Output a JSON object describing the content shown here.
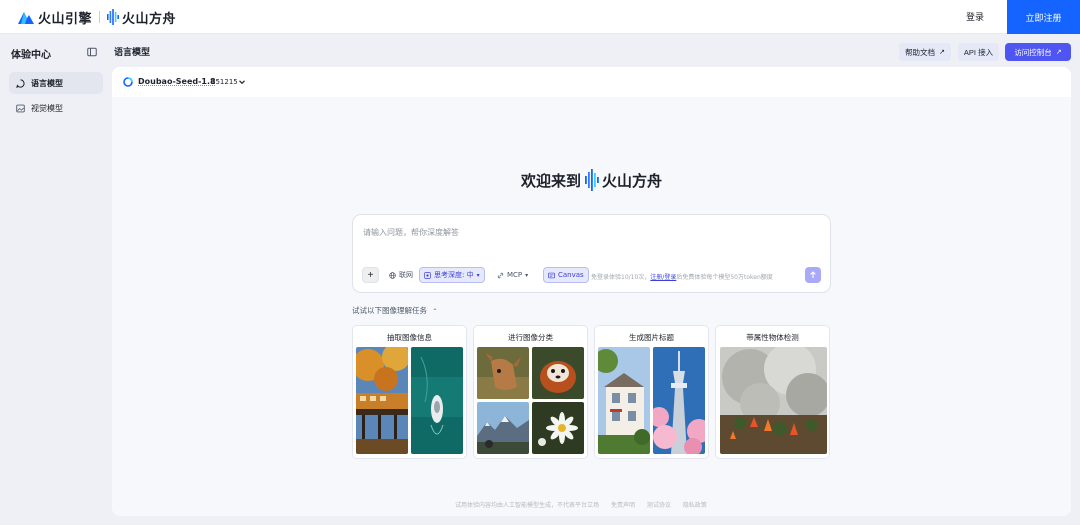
{
  "topbar": {
    "brand_engine": "火山引擎",
    "brand_ark": "火山方舟",
    "login_label": "登录",
    "signup_label": "立即注册"
  },
  "sidebar": {
    "title": "体验中心",
    "items": [
      {
        "label": "语言模型",
        "icon": "chat-bubble-icon",
        "active": true
      },
      {
        "label": "视觉模型",
        "icon": "image-icon",
        "active": false
      }
    ]
  },
  "header": {
    "title": "语言模型",
    "help_docs_label": "帮助文档",
    "api_label": "API 接入",
    "console_label": "访问控制台"
  },
  "model": {
    "name": "Doubao-Seed-1.8",
    "version": "251215"
  },
  "welcome": {
    "prefix": "欢迎来到",
    "brand": "火山方舟"
  },
  "chat": {
    "placeholder": "请输入问题，帮你深度解答",
    "web_label": "联网",
    "think_label": "思考深度: 中",
    "mcp_label": "MCP",
    "canvas_label": "Canvas",
    "hint_prefix": "免登录体验10/10次，",
    "hint_link": "注册/登录",
    "hint_suffix": "后免费体验每个模型50万token额度"
  },
  "tasks": {
    "label": "试试以下图像理解任务",
    "cards": [
      {
        "title": "抽取图像信息"
      },
      {
        "title": "进行图像分类"
      },
      {
        "title": "生成图片标题"
      },
      {
        "title": "带属性物体检测"
      }
    ]
  },
  "footer": {
    "disclaimer": "试用体验内容均由人工智能模型生成，不代表平台立场",
    "terms": "免责声明",
    "test_agreement": "测试协议",
    "privacy": "隐私政策"
  },
  "colors": {
    "primary": "#1664ff",
    "accent": "#4f55f1",
    "panel": "#f7f8fb",
    "background": "#eef0f6"
  }
}
